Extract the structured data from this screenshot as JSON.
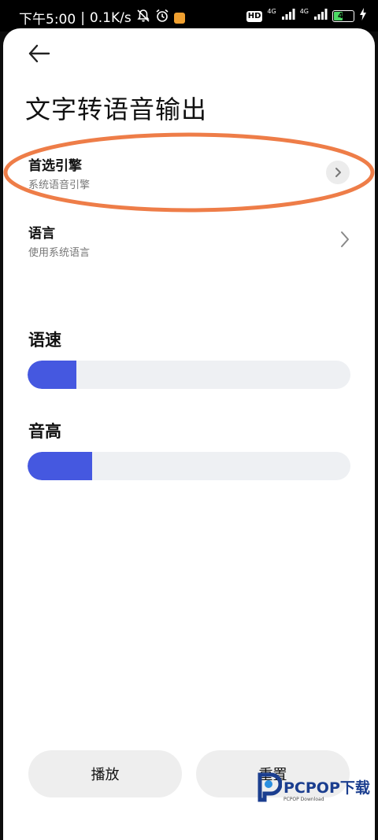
{
  "status_bar": {
    "time": "下午5:00",
    "separator": "|",
    "net_speed": "0.1K/s",
    "mute_icon": "bell-off-icon",
    "alarm_icon": "alarm-icon",
    "hd_label": "HD",
    "net_type_1": "4G",
    "net_type_2": "4G",
    "battery_level": "41",
    "battery_fraction": 0.41
  },
  "page": {
    "title": "文字转语音输出",
    "back_icon": "back-arrow-icon"
  },
  "settings": {
    "engine": {
      "title": "首选引擎",
      "subtitle": "系统语音引擎"
    },
    "language": {
      "title": "语言",
      "subtitle": "使用系统语言"
    }
  },
  "sliders": {
    "rate": {
      "label": "语速",
      "fraction": 0.15
    },
    "pitch": {
      "label": "音高",
      "fraction": 0.2
    }
  },
  "buttons": {
    "play": "播放",
    "reset": "重置"
  },
  "watermark": {
    "brand": "PCPOP下载",
    "sub": "PCPOP Download"
  },
  "colors": {
    "accent": "#4558e0",
    "annotation": "#ee7d48",
    "track": "#eef0f3",
    "button_bg": "#eeeeee"
  }
}
